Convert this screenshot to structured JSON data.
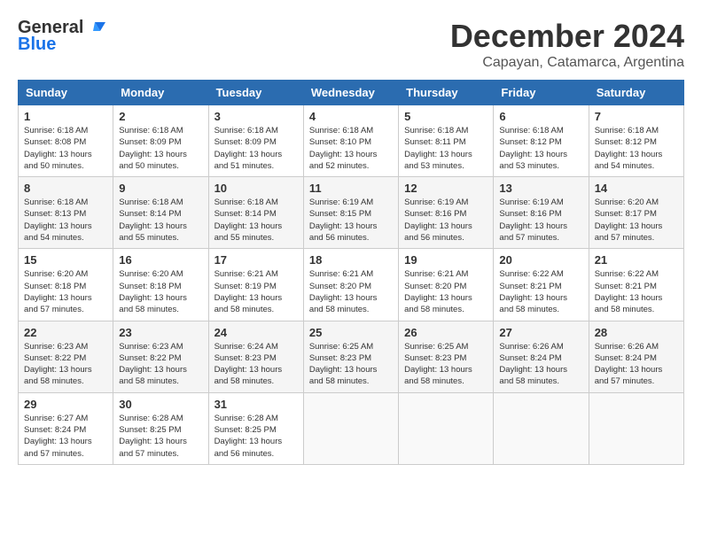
{
  "logo": {
    "line1": "General",
    "line2": "Blue"
  },
  "title": "December 2024",
  "location": "Capayan, Catamarca, Argentina",
  "days_of_week": [
    "Sunday",
    "Monday",
    "Tuesday",
    "Wednesday",
    "Thursday",
    "Friday",
    "Saturday"
  ],
  "weeks": [
    [
      {
        "day": "1",
        "sunrise": "6:18 AM",
        "sunset": "8:08 PM",
        "daylight": "13 hours and 50 minutes."
      },
      {
        "day": "2",
        "sunrise": "6:18 AM",
        "sunset": "8:09 PM",
        "daylight": "13 hours and 50 minutes."
      },
      {
        "day": "3",
        "sunrise": "6:18 AM",
        "sunset": "8:09 PM",
        "daylight": "13 hours and 51 minutes."
      },
      {
        "day": "4",
        "sunrise": "6:18 AM",
        "sunset": "8:10 PM",
        "daylight": "13 hours and 52 minutes."
      },
      {
        "day": "5",
        "sunrise": "6:18 AM",
        "sunset": "8:11 PM",
        "daylight": "13 hours and 53 minutes."
      },
      {
        "day": "6",
        "sunrise": "6:18 AM",
        "sunset": "8:12 PM",
        "daylight": "13 hours and 53 minutes."
      },
      {
        "day": "7",
        "sunrise": "6:18 AM",
        "sunset": "8:12 PM",
        "daylight": "13 hours and 54 minutes."
      }
    ],
    [
      {
        "day": "8",
        "sunrise": "6:18 AM",
        "sunset": "8:13 PM",
        "daylight": "13 hours and 54 minutes."
      },
      {
        "day": "9",
        "sunrise": "6:18 AM",
        "sunset": "8:14 PM",
        "daylight": "13 hours and 55 minutes."
      },
      {
        "day": "10",
        "sunrise": "6:18 AM",
        "sunset": "8:14 PM",
        "daylight": "13 hours and 55 minutes."
      },
      {
        "day": "11",
        "sunrise": "6:19 AM",
        "sunset": "8:15 PM",
        "daylight": "13 hours and 56 minutes."
      },
      {
        "day": "12",
        "sunrise": "6:19 AM",
        "sunset": "8:16 PM",
        "daylight": "13 hours and 56 minutes."
      },
      {
        "day": "13",
        "sunrise": "6:19 AM",
        "sunset": "8:16 PM",
        "daylight": "13 hours and 57 minutes."
      },
      {
        "day": "14",
        "sunrise": "6:20 AM",
        "sunset": "8:17 PM",
        "daylight": "13 hours and 57 minutes."
      }
    ],
    [
      {
        "day": "15",
        "sunrise": "6:20 AM",
        "sunset": "8:18 PM",
        "daylight": "13 hours and 57 minutes."
      },
      {
        "day": "16",
        "sunrise": "6:20 AM",
        "sunset": "8:18 PM",
        "daylight": "13 hours and 58 minutes."
      },
      {
        "day": "17",
        "sunrise": "6:21 AM",
        "sunset": "8:19 PM",
        "daylight": "13 hours and 58 minutes."
      },
      {
        "day": "18",
        "sunrise": "6:21 AM",
        "sunset": "8:20 PM",
        "daylight": "13 hours and 58 minutes."
      },
      {
        "day": "19",
        "sunrise": "6:21 AM",
        "sunset": "8:20 PM",
        "daylight": "13 hours and 58 minutes."
      },
      {
        "day": "20",
        "sunrise": "6:22 AM",
        "sunset": "8:21 PM",
        "daylight": "13 hours and 58 minutes."
      },
      {
        "day": "21",
        "sunrise": "6:22 AM",
        "sunset": "8:21 PM",
        "daylight": "13 hours and 58 minutes."
      }
    ],
    [
      {
        "day": "22",
        "sunrise": "6:23 AM",
        "sunset": "8:22 PM",
        "daylight": "13 hours and 58 minutes."
      },
      {
        "day": "23",
        "sunrise": "6:23 AM",
        "sunset": "8:22 PM",
        "daylight": "13 hours and 58 minutes."
      },
      {
        "day": "24",
        "sunrise": "6:24 AM",
        "sunset": "8:23 PM",
        "daylight": "13 hours and 58 minutes."
      },
      {
        "day": "25",
        "sunrise": "6:25 AM",
        "sunset": "8:23 PM",
        "daylight": "13 hours and 58 minutes."
      },
      {
        "day": "26",
        "sunrise": "6:25 AM",
        "sunset": "8:23 PM",
        "daylight": "13 hours and 58 minutes."
      },
      {
        "day": "27",
        "sunrise": "6:26 AM",
        "sunset": "8:24 PM",
        "daylight": "13 hours and 58 minutes."
      },
      {
        "day": "28",
        "sunrise": "6:26 AM",
        "sunset": "8:24 PM",
        "daylight": "13 hours and 57 minutes."
      }
    ],
    [
      {
        "day": "29",
        "sunrise": "6:27 AM",
        "sunset": "8:24 PM",
        "daylight": "13 hours and 57 minutes."
      },
      {
        "day": "30",
        "sunrise": "6:28 AM",
        "sunset": "8:25 PM",
        "daylight": "13 hours and 57 minutes."
      },
      {
        "day": "31",
        "sunrise": "6:28 AM",
        "sunset": "8:25 PM",
        "daylight": "13 hours and 56 minutes."
      },
      null,
      null,
      null,
      null
    ]
  ]
}
